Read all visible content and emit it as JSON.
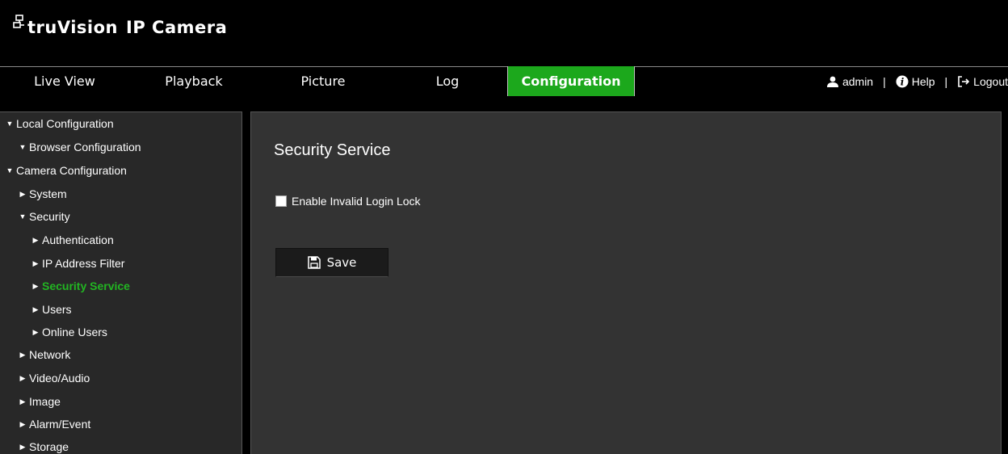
{
  "header": {
    "brand": "truVision",
    "product": "IP Camera"
  },
  "nav": {
    "tabs": [
      {
        "label": "Live View"
      },
      {
        "label": "Playback"
      },
      {
        "label": "Picture"
      },
      {
        "label": "Log"
      },
      {
        "label": "Configuration",
        "active": true
      }
    ],
    "user": "admin",
    "help": "Help",
    "logout": "Logout",
    "separator": "|"
  },
  "sidebar": {
    "items": [
      {
        "label": "Local Configuration",
        "state": "expanded"
      },
      {
        "label": "Browser Configuration",
        "state": "expanded"
      },
      {
        "label": "Camera Configuration",
        "state": "expanded"
      },
      {
        "label": "System",
        "state": "collapsed"
      },
      {
        "label": "Security",
        "state": "expanded"
      },
      {
        "label": "Authentication",
        "state": "collapsed"
      },
      {
        "label": "IP Address Filter",
        "state": "collapsed"
      },
      {
        "label": "Security Service",
        "state": "collapsed",
        "active": true
      },
      {
        "label": "Users",
        "state": "collapsed"
      },
      {
        "label": "Online Users",
        "state": "collapsed"
      },
      {
        "label": "Network",
        "state": "collapsed"
      },
      {
        "label": "Video/Audio",
        "state": "collapsed"
      },
      {
        "label": "Image",
        "state": "collapsed"
      },
      {
        "label": "Alarm/Event",
        "state": "collapsed"
      },
      {
        "label": "Storage",
        "state": "collapsed"
      }
    ]
  },
  "main": {
    "title": "Security Service",
    "checkbox_label": "Enable Invalid Login Lock",
    "checkbox_checked": false,
    "save_label": "Save"
  },
  "colors": {
    "accent": "#1ca81c",
    "active_text": "#22b522",
    "panel_bg": "#333333",
    "sidebar_bg": "#282828"
  },
  "icons": {
    "logo": "network-logo-icon",
    "user": "user-icon",
    "help": "help-icon",
    "logout": "logout-icon",
    "save": "floppy-disk-icon",
    "expanded": "triangle-down-icon",
    "collapsed": "triangle-right-icon"
  }
}
